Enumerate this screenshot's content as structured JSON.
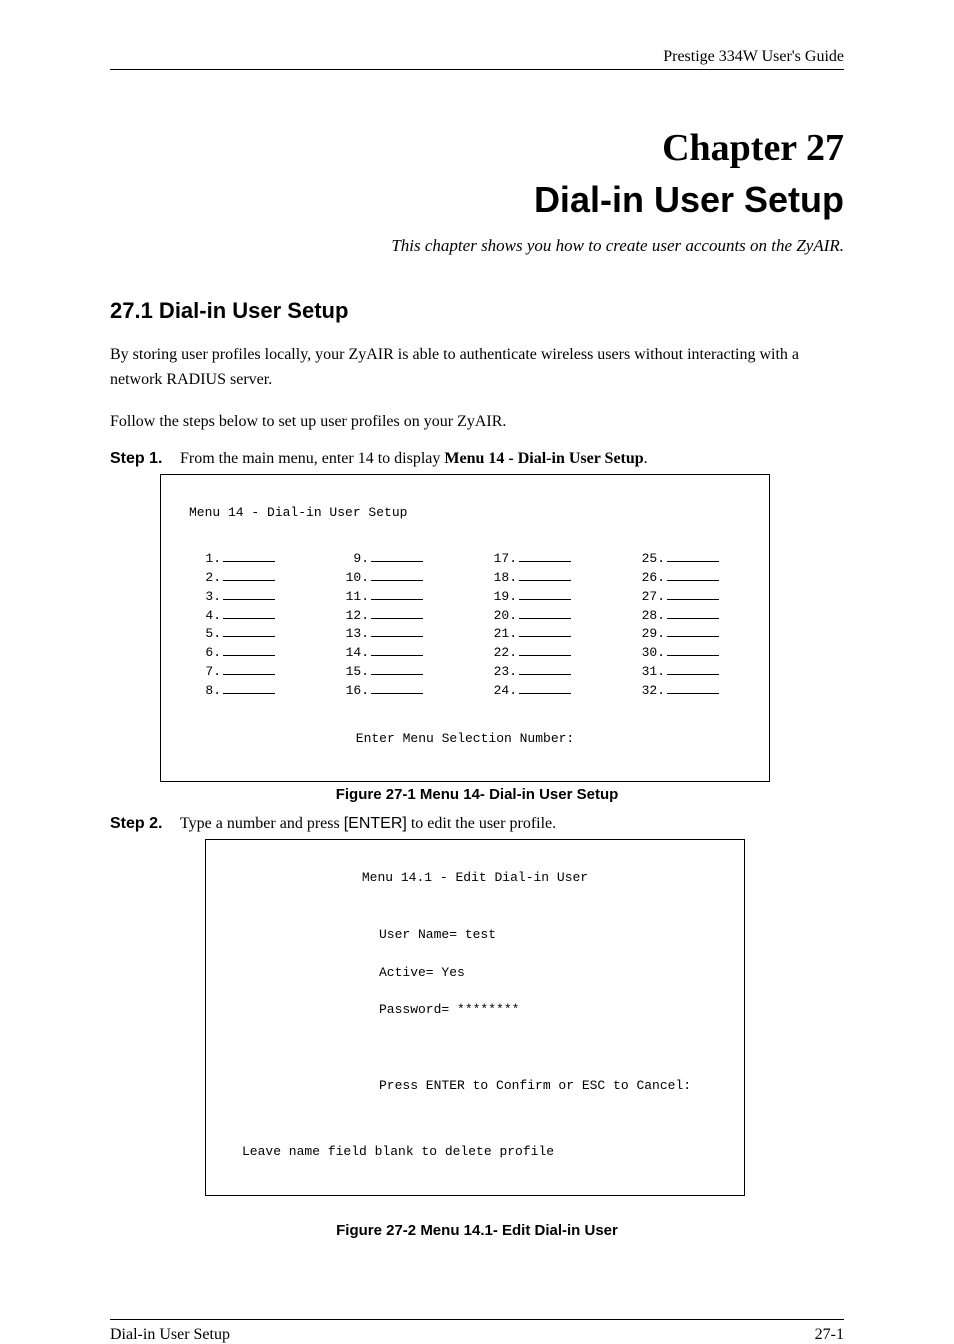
{
  "header": {
    "guide_name": "Prestige 334W User's Guide"
  },
  "chapter": {
    "number": "Chapter 27",
    "title": "Dial-in User Setup",
    "description": "This chapter shows you how to create user accounts on the ZyAIR."
  },
  "section": {
    "number": "27.1",
    "title": "Dial-in User Setup",
    "heading": "27.1  Dial-in User Setup",
    "paragraph1": "By storing user profiles locally, your ZyAIR is able to authenticate wireless users without interacting with a network RADIUS server.",
    "paragraph2": "Follow the steps below to set up user profiles on your ZyAIR."
  },
  "steps": [
    {
      "label": "Step 1.",
      "text_prefix": "From the main menu, enter 14 to display ",
      "text_bold": "Menu 14 - Dial-in User Setup",
      "text_suffix": "."
    },
    {
      "label": "Step 2.",
      "text_prefix": "Type a number and press ",
      "text_enter": "[ENTER]",
      "text_suffix": " to edit the user profile."
    }
  ],
  "figure1": {
    "menu_title": "Menu 14 - Dial-in User Setup",
    "columns": [
      [
        "1.",
        "2.",
        "3.",
        "4.",
        "5.",
        "6.",
        "7.",
        "8."
      ],
      [
        "9.",
        "10.",
        "11.",
        "12.",
        "13.",
        "14.",
        "15.",
        "16."
      ],
      [
        "17.",
        "18.",
        "19.",
        "20.",
        "21.",
        "22.",
        "23.",
        "24."
      ],
      [
        "25.",
        "26.",
        "27.",
        "28.",
        "29.",
        "30.",
        "31.",
        "32."
      ]
    ],
    "prompt": "Enter Menu Selection Number:",
    "caption": "Figure 27-1 Menu 14- Dial-in User Setup"
  },
  "figure2": {
    "menu_title": "Menu 14.1 - Edit Dial-in User",
    "fields": {
      "user_name_label": "User Name=",
      "user_name_value": "test",
      "active_label": "Active=",
      "active_value": "Yes",
      "password_label": "Password=",
      "password_value": "********"
    },
    "confirm_line": "Press ENTER to Confirm or ESC to Cancel:",
    "footer_line": "Leave name field blank to delete profile",
    "caption": "Figure 27-2 Menu 14.1- Edit Dial-in User"
  },
  "footer": {
    "left": "Dial-in User Setup",
    "right": "27-1"
  }
}
